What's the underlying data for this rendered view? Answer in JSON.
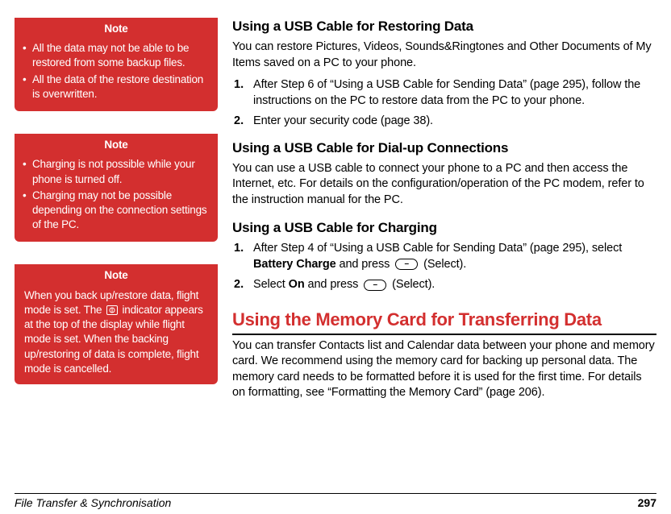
{
  "notes": [
    {
      "title": "Note",
      "items": [
        "All the data may not be able to be restored from some backup files.",
        "All the data of the restore destination is overwritten."
      ]
    },
    {
      "title": "Note",
      "items": [
        "Charging is not possible while your phone is turned off.",
        "Charging may not be possible depending on the connection settings of the PC."
      ]
    },
    {
      "title": "Note",
      "para_before": "When you back up/restore data, flight mode is set. The ",
      "para_after": " indicator appears at the top of the display while flight mode is set. When the backing up/restoring of data is complete, flight mode is cancelled."
    }
  ],
  "main": {
    "h_restore": "Using a USB Cable for Restoring Data",
    "restore_intro": "You can restore Pictures, Videos, Sounds&Ringtones and Other Documents of My Items saved on a PC to your phone.",
    "restore_steps": [
      "After Step 6 of “Using a USB Cable for Sending Data” (page 295), follow the instructions on the PC to restore data from the PC to your phone.",
      "Enter your security code (page 38)."
    ],
    "h_dialup": "Using a USB Cable for Dial-up Connections",
    "dialup_para": "You can use a USB cable to connect your phone to a PC and then access the Internet, etc. For details on the configuration/operation of the PC modem, refer to the instruction manual for the PC.",
    "h_charging": "Using a USB Cable for Charging",
    "charging_step1_a": "After Step 4 of “Using a USB Cable for Sending Data” (page 295), select ",
    "charging_step1_bold": "Battery Charge",
    "charging_step1_b": " and press ",
    "charging_step1_c": " (Select).",
    "charging_step2_a": "Select ",
    "charging_step2_bold": "On",
    "charging_step2_b": " and press ",
    "charging_step2_c": " (Select).",
    "big_title": "Using the Memory Card for Transferring Data",
    "mem_para": "You can transfer Contacts list and Calendar data between your phone and memory card. We recommend using the memory card for backing up personal data. The memory card needs to be formatted before it is used for the first time. For details on formatting, see “Formatting the Memory Card” (page 206)."
  },
  "footer": {
    "section": "File Transfer & Synchronisation",
    "page": "297"
  }
}
